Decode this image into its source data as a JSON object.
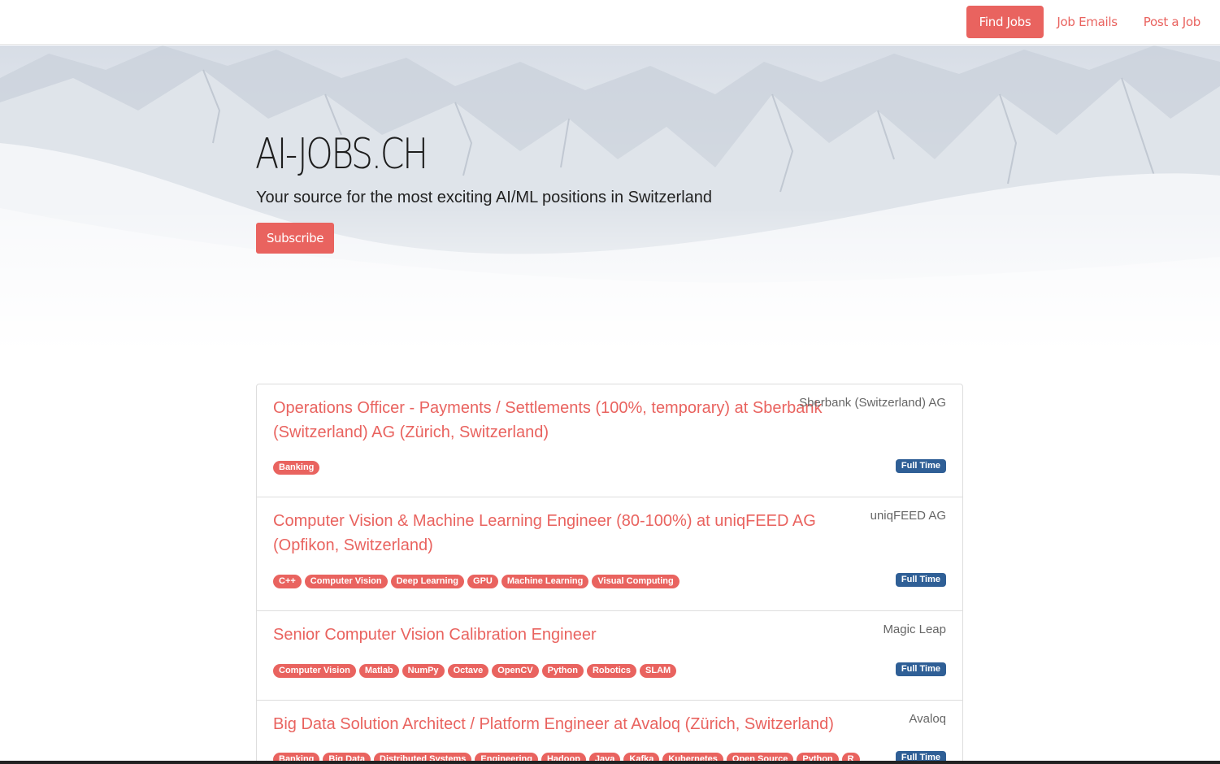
{
  "nav": {
    "items": [
      {
        "label": "Find Jobs",
        "active": true
      },
      {
        "label": "Job Emails",
        "active": false
      },
      {
        "label": "Post a Job",
        "active": false
      }
    ]
  },
  "hero": {
    "title": "AI-JOBS.CH",
    "subtitle": "Your source for the most exciting AI/ML positions in Switzerland",
    "subscribe_label": "Subscribe"
  },
  "jobs": [
    {
      "title": "Operations Officer - Payments / Settlements (100%, temporary) at Sberbank (Switzerland) AG (Zürich, Switzerland)",
      "company": "Sberbank (Switzerland) AG",
      "tags": [
        "Banking"
      ],
      "type": "Full Time"
    },
    {
      "title": "Computer Vision & Machine Learning Engineer (80-100%) at uniqFEED AG (Opfikon, Switzerland)",
      "company": "uniqFEED AG",
      "tags": [
        "C++",
        "Computer Vision",
        "Deep Learning",
        "GPU",
        "Machine Learning",
        "Visual Computing"
      ],
      "type": "Full Time"
    },
    {
      "title": "Senior Computer Vision Calibration Engineer",
      "company": "Magic Leap",
      "tags": [
        "Computer Vision",
        "Matlab",
        "NumPy",
        "Octave",
        "OpenCV",
        "Python",
        "Robotics",
        "SLAM"
      ],
      "type": "Full Time"
    },
    {
      "title": "Big Data Solution Architect / Platform Engineer at Avaloq (Zürich, Switzerland)",
      "company": "Avaloq",
      "tags": [
        "Banking",
        "Big Data",
        "Distributed Systems",
        "Engineering",
        "Hadoop",
        "Java",
        "Kafka",
        "Kubernetes",
        "Open Source",
        "Python",
        "R"
      ],
      "type": "Full Time"
    }
  ],
  "colors": {
    "accent": "#e9635f",
    "badge": "#2f5f96"
  }
}
